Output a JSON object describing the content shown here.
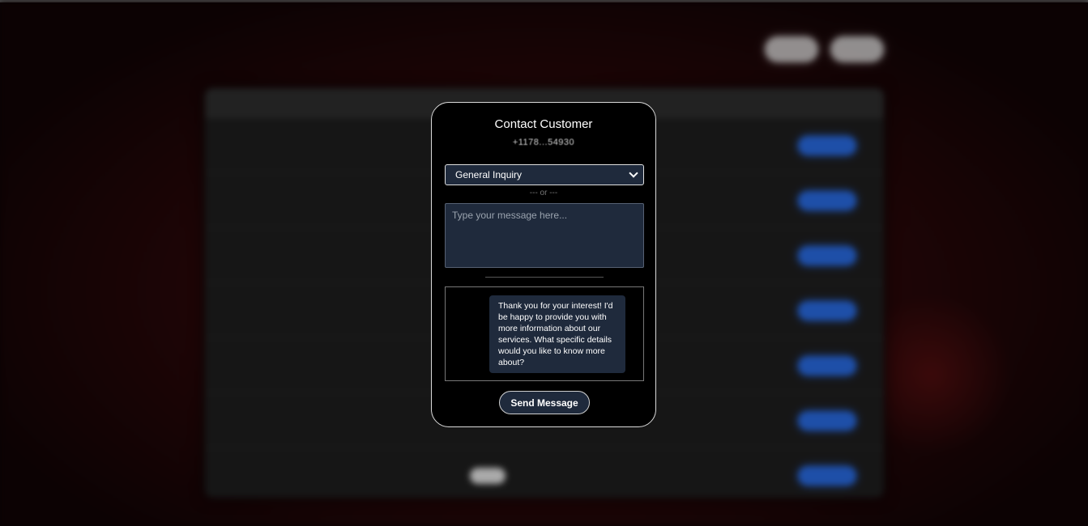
{
  "modal": {
    "title": "Contact Customer",
    "phone": "+1178...54930",
    "template_select": {
      "selected": "General Inquiry"
    },
    "or_separator": "--- or ---",
    "message_input": {
      "value": "",
      "placeholder": "Type your message here..."
    },
    "preview_message": "Thank you for your interest! I'd be happy to provide you with more information about our services. What specific details would you like to know more about?",
    "send_label": "Send Message"
  },
  "colors": {
    "modal_bg": "#000000",
    "field_bg": "#1f2a3c",
    "accent_blue": "#1e4fa8",
    "backdrop_red": "#3a0b0d"
  }
}
